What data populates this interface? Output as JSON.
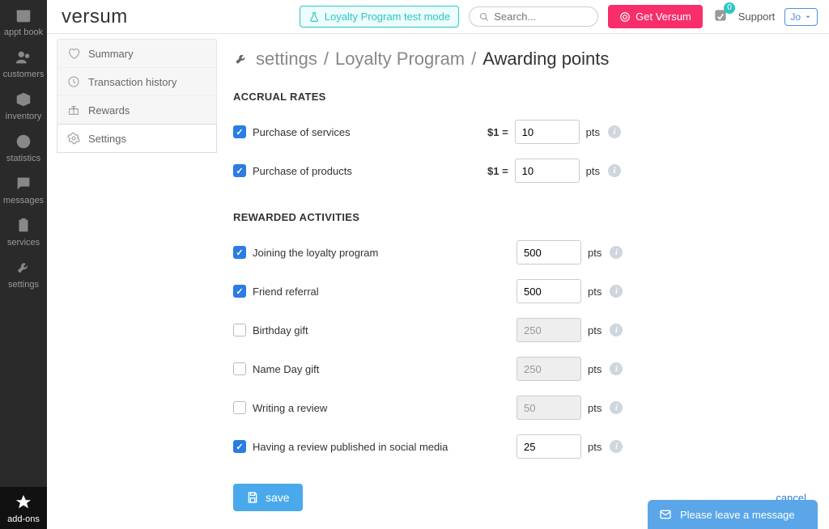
{
  "mainNav": {
    "items": [
      {
        "label": "appt book"
      },
      {
        "label": "customers"
      },
      {
        "label": "inventory"
      },
      {
        "label": "statistics"
      },
      {
        "label": "messages"
      },
      {
        "label": "services"
      },
      {
        "label": "settings"
      }
    ],
    "bottomItem": {
      "label": "add-ons"
    }
  },
  "header": {
    "logo": "versum",
    "testMode": "Loyalty Program test mode",
    "searchPlaceholder": "Search...",
    "getVersum": "Get Versum",
    "notifCount": "0",
    "support": "Support",
    "user": "Jo"
  },
  "subNav": {
    "items": [
      {
        "label": "Summary"
      },
      {
        "label": "Transaction history"
      },
      {
        "label": "Rewards"
      },
      {
        "label": "Settings"
      }
    ]
  },
  "breadcrumb": {
    "a": "settings",
    "b": "Loyalty Program",
    "c": "Awarding points"
  },
  "accrual": {
    "title": "ACCRUAL RATES",
    "rows": [
      {
        "label": "Purchase of services",
        "checked": true,
        "prefix": "$1 =",
        "value": "10",
        "suffix": "pts"
      },
      {
        "label": "Purchase of products",
        "checked": true,
        "prefix": "$1 =",
        "value": "10",
        "suffix": "pts"
      }
    ]
  },
  "rewarded": {
    "title": "REWARDED ACTIVITIES",
    "rows": [
      {
        "label": "Joining the loyalty program",
        "checked": true,
        "value": "500",
        "suffix": "pts"
      },
      {
        "label": "Friend referral",
        "checked": true,
        "value": "500",
        "suffix": "pts"
      },
      {
        "label": "Birthday gift",
        "checked": false,
        "value": "250",
        "suffix": "pts"
      },
      {
        "label": "Name Day gift",
        "checked": false,
        "value": "250",
        "suffix": "pts"
      },
      {
        "label": "Writing a review",
        "checked": false,
        "value": "50",
        "suffix": "pts"
      },
      {
        "label": "Having a review published in social media",
        "checked": true,
        "value": "25",
        "suffix": "pts"
      }
    ]
  },
  "actions": {
    "save": "save",
    "cancel": "cancel"
  },
  "chat": {
    "text": "Please leave a message"
  }
}
